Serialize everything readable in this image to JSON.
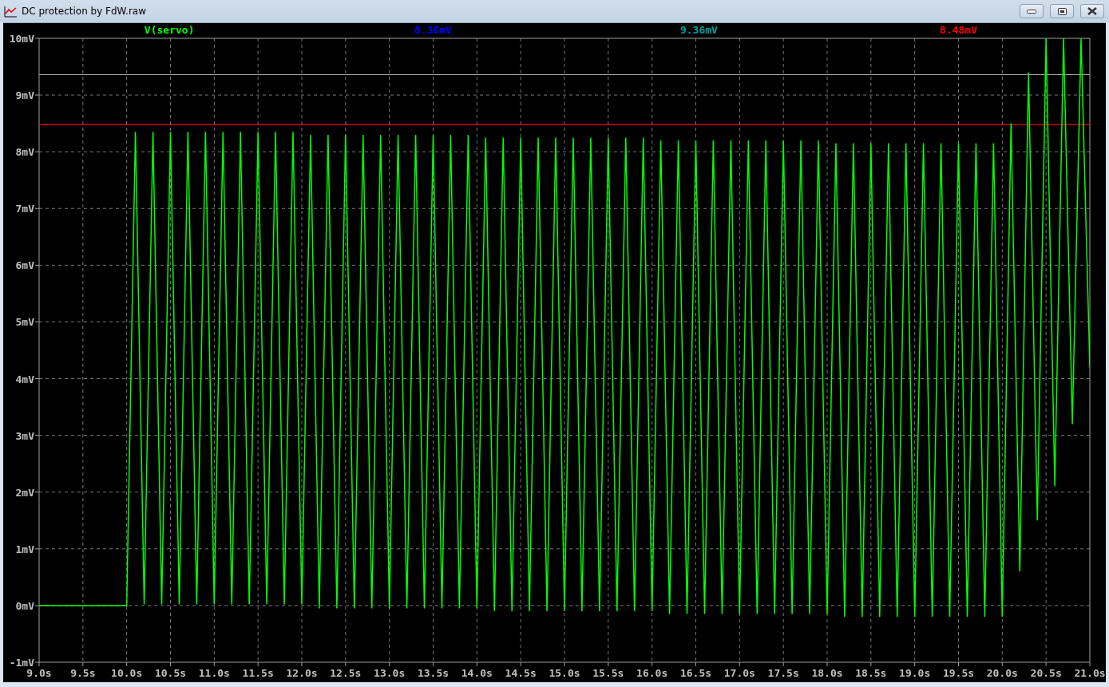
{
  "window": {
    "title": "DC protection by FdW.raw"
  },
  "plot": {
    "readouts": [
      {
        "text": "8.36mV",
        "color": "#0000ff"
      },
      {
        "text": "9.36mV",
        "color": "#00a0a0"
      },
      {
        "text": "8.48mV",
        "color": "#ff0000"
      }
    ],
    "chart_data": {
      "type": "line",
      "xlim": [
        9.0,
        21.0
      ],
      "ylim": [
        -1,
        10
      ],
      "xticks": [
        {
          "value": 9.0,
          "label": "9.0s"
        },
        {
          "value": 9.5,
          "label": "9.5s"
        },
        {
          "value": 10.0,
          "label": "10.0s"
        },
        {
          "value": 10.5,
          "label": "10.5s"
        },
        {
          "value": 11.0,
          "label": "11.0s"
        },
        {
          "value": 11.5,
          "label": "11.5s"
        },
        {
          "value": 12.0,
          "label": "12.0s"
        },
        {
          "value": 12.5,
          "label": "12.5s"
        },
        {
          "value": 13.0,
          "label": "13.0s"
        },
        {
          "value": 13.5,
          "label": "13.5s"
        },
        {
          "value": 14.0,
          "label": "14.0s"
        },
        {
          "value": 14.5,
          "label": "14.5s"
        },
        {
          "value": 15.0,
          "label": "15.0s"
        },
        {
          "value": 15.5,
          "label": "15.5s"
        },
        {
          "value": 16.0,
          "label": "16.0s"
        },
        {
          "value": 16.5,
          "label": "16.5s"
        },
        {
          "value": 17.0,
          "label": "17.0s"
        },
        {
          "value": 17.5,
          "label": "17.5s"
        },
        {
          "value": 18.0,
          "label": "18.0s"
        },
        {
          "value": 18.5,
          "label": "18.5s"
        },
        {
          "value": 19.0,
          "label": "19.0s"
        },
        {
          "value": 19.5,
          "label": "19.5s"
        },
        {
          "value": 20.0,
          "label": "20.0s"
        },
        {
          "value": 20.5,
          "label": "20.5s"
        },
        {
          "value": 21.0,
          "label": "21.0s"
        }
      ],
      "yticks": [
        {
          "value": 10,
          "label": "10mV"
        },
        {
          "value": 9,
          "label": "9mV"
        },
        {
          "value": 8,
          "label": "8mV"
        },
        {
          "value": 7,
          "label": "7mV"
        },
        {
          "value": 6,
          "label": "6mV"
        },
        {
          "value": 5,
          "label": "5mV"
        },
        {
          "value": 4,
          "label": "4mV"
        },
        {
          "value": 3,
          "label": "3mV"
        },
        {
          "value": 2,
          "label": "2mV"
        },
        {
          "value": 1,
          "label": "1mV"
        },
        {
          "value": 0,
          "label": "0mV"
        },
        {
          "value": -1,
          "label": "-1mV"
        }
      ],
      "x": [
        9.0,
        10.0,
        10.1,
        10.2,
        10.3,
        10.4,
        10.5,
        10.6,
        10.7,
        10.8,
        10.9,
        11.0,
        11.1,
        11.2,
        11.3,
        11.4,
        11.5,
        11.6,
        11.7,
        11.8,
        11.9,
        12.0,
        12.1,
        12.2,
        12.3,
        12.4,
        12.5,
        12.6,
        12.7,
        12.8,
        12.9,
        13.0,
        13.1,
        13.2,
        13.3,
        13.4,
        13.5,
        13.6,
        13.7,
        13.8,
        13.9,
        14.0,
        14.1,
        14.2,
        14.3,
        14.4,
        14.5,
        14.6,
        14.7,
        14.8,
        14.9,
        15.0,
        15.1,
        15.2,
        15.3,
        15.4,
        15.5,
        15.6,
        15.7,
        15.8,
        15.9,
        16.0,
        16.1,
        16.2,
        16.3,
        16.4,
        16.5,
        16.6,
        16.7,
        16.8,
        16.9,
        17.0,
        17.1,
        17.2,
        17.3,
        17.4,
        17.5,
        17.6,
        17.7,
        17.8,
        17.9,
        18.0,
        18.1,
        18.2,
        18.3,
        18.4,
        18.5,
        18.6,
        18.7,
        18.8,
        18.9,
        19.0,
        19.1,
        19.2,
        19.3,
        19.4,
        19.5,
        19.6,
        19.7,
        19.8,
        19.9,
        20.0,
        20.1,
        20.2,
        20.3,
        20.4,
        20.5,
        20.6,
        20.7,
        20.8,
        20.9,
        21.0
      ],
      "series": [
        {
          "name": "V(servo)",
          "color": "#00ff00",
          "values": [
            0,
            0,
            8.35,
            0.02,
            8.35,
            0.02,
            8.35,
            0.02,
            8.35,
            0.02,
            8.35,
            0.02,
            8.35,
            0.02,
            8.35,
            0.02,
            8.35,
            0.02,
            8.35,
            0.02,
            8.35,
            0.02,
            8.3,
            -0.05,
            8.3,
            -0.05,
            8.3,
            -0.05,
            8.3,
            -0.05,
            8.3,
            -0.05,
            8.3,
            -0.05,
            8.3,
            -0.05,
            8.3,
            -0.05,
            8.3,
            -0.05,
            8.3,
            -0.05,
            8.25,
            -0.1,
            8.25,
            -0.1,
            8.25,
            -0.1,
            8.25,
            -0.1,
            8.25,
            -0.1,
            8.25,
            -0.1,
            8.25,
            -0.1,
            8.25,
            -0.1,
            8.25,
            -0.1,
            8.25,
            -0.1,
            8.2,
            -0.15,
            8.2,
            -0.15,
            8.2,
            -0.15,
            8.2,
            -0.15,
            8.2,
            -0.15,
            8.2,
            -0.15,
            8.2,
            -0.15,
            8.2,
            -0.15,
            8.2,
            -0.15,
            8.2,
            -0.15,
            8.15,
            -0.2,
            8.15,
            -0.2,
            8.15,
            -0.2,
            8.15,
            -0.2,
            8.15,
            -0.2,
            8.15,
            -0.2,
            8.15,
            -0.2,
            8.15,
            -0.2,
            8.15,
            -0.2,
            8.15,
            -0.2,
            8.5,
            0.6,
            9.4,
            1.5,
            10,
            2.1,
            10,
            3.2,
            10,
            4.2
          ]
        }
      ],
      "grid": true,
      "ref_lines": [
        {
          "axis": "y",
          "value": 9.36,
          "color": "#a0a0a0"
        },
        {
          "axis": "y",
          "value": 8.48,
          "color": "#ff0000"
        }
      ]
    }
  }
}
